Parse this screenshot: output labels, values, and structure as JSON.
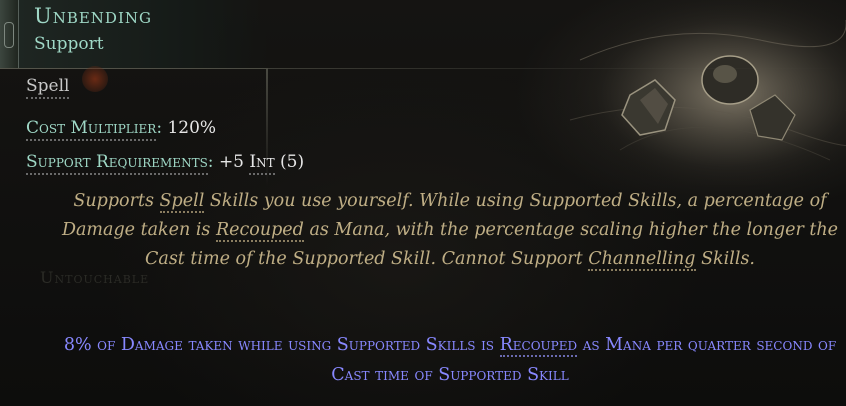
{
  "tooltip": {
    "name": "Unbending",
    "type": "Support",
    "tag": "Spell",
    "cost_label": "Cost Multiplier",
    "cost_value": "120%",
    "req_label": "Support Requirements",
    "req_value_prefix": "+5",
    "req_attr": "Int",
    "req_current": "(5)",
    "description": {
      "p1": "Supports ",
      "kw1": "Spell",
      "p2": " Skills you use yourself. While using Supported Skills, a percentage of Damage taken is ",
      "kw2": "Recouped",
      "p3": " as Mana, with the percentage scaling higher the longer the Cast time of the Supported Skill. Cannot Support ",
      "kw3": "Channelling",
      "p4": " Skills."
    },
    "modifier": {
      "p1": "8% of Damage taken while using Supported Skills is ",
      "kw": "Recouped",
      "p2": " as Mana per quarter second of Cast time of Supported Skill"
    },
    "background_text": "Untouchable"
  },
  "colors": {
    "gem_name": "#9fd8c6",
    "description": "#bfae85",
    "modifier": "#8888ff",
    "value": "#e6e6e6"
  },
  "icons": {
    "art": "support-gem-art-image",
    "frame": "tooltip-frame-ornament"
  }
}
